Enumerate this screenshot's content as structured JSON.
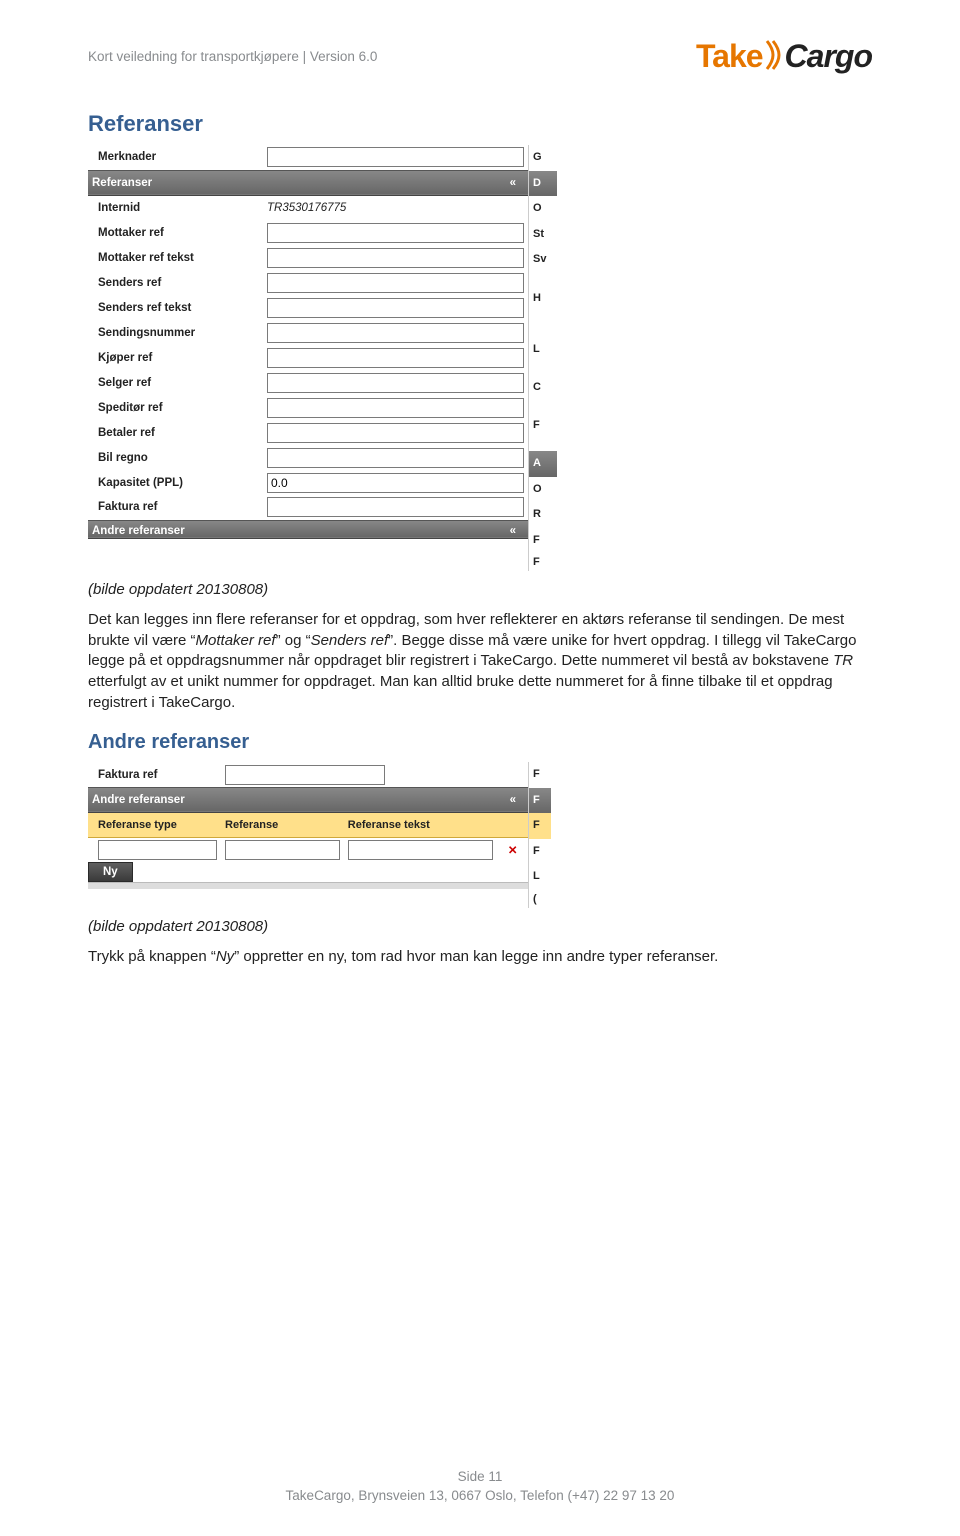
{
  "header": {
    "doc_title": "Kort veiledning for transportkjøpere | Version 6.0",
    "logo_take": "Take",
    "logo_cargo": "Cargo"
  },
  "section1": {
    "title": "Referanser",
    "caption": "(bilde oppdatert 20130808)",
    "body_para": "Det kan legges inn flere referanser for et oppdrag, som hver reflekterer en aktørs referanse til sendingen.  De mest brukte vil være \"Mottaker ref\" og \"Senders ref\".  Begge disse må være unike for hvert oppdrag.  I tillegg vil TakeCargo legge på et oppdragsnummer når oppdraget blir registrert i TakeCargo. Dette nummeret vil bestå av bokstavene TR etterfulgt av et unikt nummer for oppdraget. Man kan alltid bruke dette nummeret for å finne tilbake til et oppdrag registrert i TakeCargo.",
    "form": {
      "merknader_label": "Merknader",
      "merknader_value": "",
      "section_title": "Referanser",
      "collapse_glyph": "«",
      "rows": [
        {
          "label": "Internid",
          "value": "TR3530176775",
          "readonly": true
        },
        {
          "label": "Mottaker ref",
          "value": ""
        },
        {
          "label": "Mottaker ref tekst",
          "value": ""
        },
        {
          "label": "Senders ref",
          "value": ""
        },
        {
          "label": "Senders ref tekst",
          "value": ""
        },
        {
          "label": "Sendingsnummer",
          "value": ""
        },
        {
          "label": "Kjøper ref",
          "value": ""
        },
        {
          "label": "Selger ref",
          "value": ""
        },
        {
          "label": "Speditør ref",
          "value": ""
        },
        {
          "label": "Betaler ref",
          "value": ""
        },
        {
          "label": "Bil regno",
          "value": ""
        },
        {
          "label": "Kapasitet (PPL)",
          "value": "0.0"
        },
        {
          "label": "Faktura ref",
          "value": ""
        }
      ],
      "footer_section": "Andre referanser"
    },
    "right_stub": [
      "G",
      "D",
      "O",
      "St",
      "Sv",
      "H",
      "L",
      "C",
      "F",
      "A",
      "O",
      "R",
      "F",
      "F"
    ]
  },
  "section2": {
    "title": "Andre referanser",
    "caption": "(bilde oppdatert 20130808)",
    "body_para": "Trykk på knappen \"Ny\" oppretter en ny, tom rad hvor man kan legge inn andre typer referanser.",
    "form": {
      "faktura_label": "Faktura ref",
      "faktura_value": "",
      "section_title": "Andre referanser",
      "collapse_glyph": "«",
      "columns": [
        "Referanse type",
        "Referanse",
        "Referanse tekst"
      ],
      "ny_label": "Ny"
    },
    "right_stub": [
      "F",
      "F",
      "F",
      "F",
      "L",
      "("
    ]
  },
  "footer": {
    "page_line": "Side 11",
    "addr_line": "TakeCargo, Brynsveien 13, 0667 Oslo, Telefon (+47)  22 97 13 20"
  }
}
